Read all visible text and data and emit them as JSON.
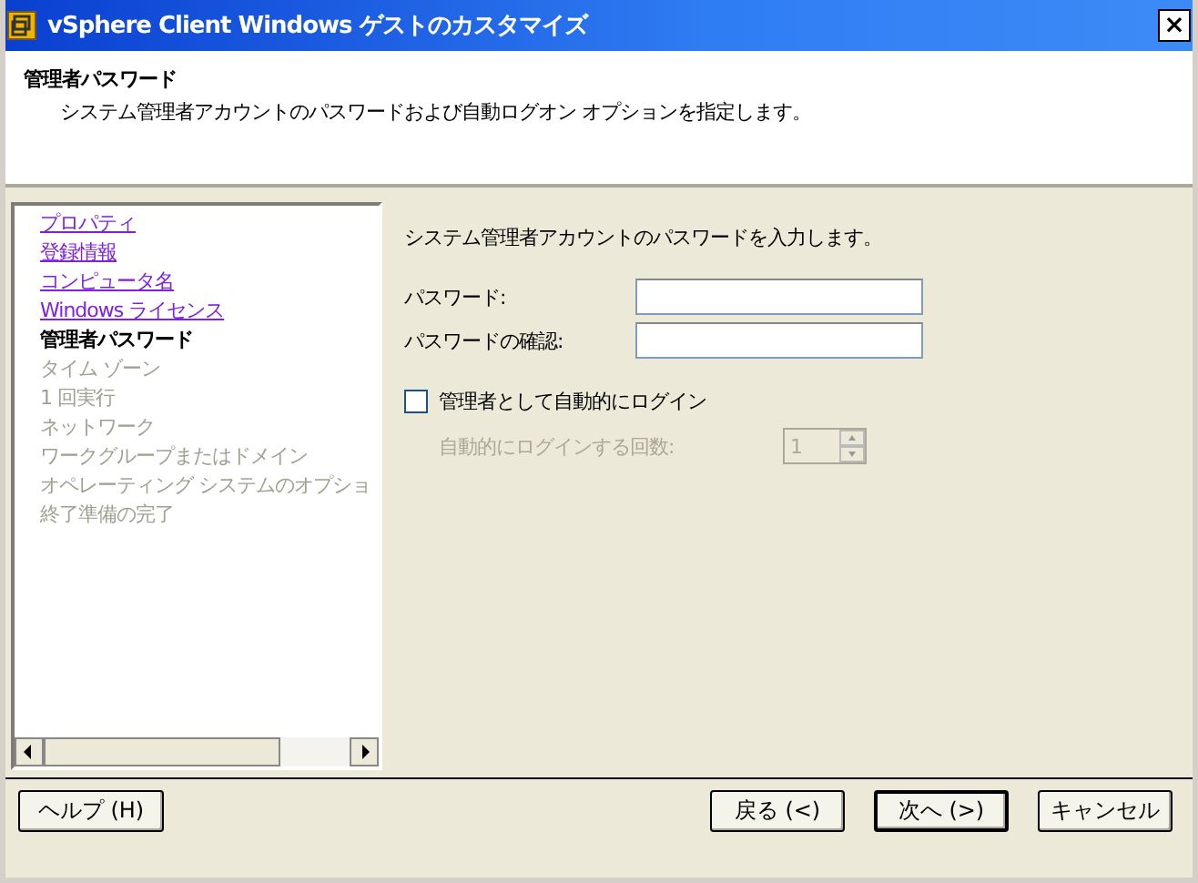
{
  "window": {
    "title": "vSphere Client Windows ゲストのカスタマイズ",
    "close": "×"
  },
  "header": {
    "title": "管理者パスワード",
    "description": "システム管理者アカウントのパスワードおよび自動ログオン オプションを指定します。"
  },
  "steps": [
    {
      "label": "プロパティ",
      "kind": "visited"
    },
    {
      "label": "登録情報",
      "kind": "visited"
    },
    {
      "label": "コンピュータ名",
      "kind": "visited"
    },
    {
      "label": "Windows ライセンス",
      "kind": "visited"
    },
    {
      "label": "管理者パスワード",
      "kind": "current"
    },
    {
      "label": "タイム ゾーン",
      "kind": "pending"
    },
    {
      "label": "1 回実行",
      "kind": "pending"
    },
    {
      "label": "ネットワーク",
      "kind": "pending"
    },
    {
      "label": "ワークグループまたはドメイン",
      "kind": "pending"
    },
    {
      "label": "オペレーティング システムのオプショ",
      "kind": "pending"
    },
    {
      "label": "終了準備の完了",
      "kind": "pending"
    }
  ],
  "form": {
    "intro": "システム管理者アカウントのパスワードを入力します。",
    "fields": [
      {
        "label": "パスワード:"
      },
      {
        "label": "パスワードの確認:"
      }
    ],
    "auto_login": {
      "label": "管理者として自動的にログイン",
      "checked": false
    },
    "login_count": {
      "label": "自動的にログインする回数:",
      "value": "1",
      "disabled": true
    }
  },
  "buttons": {
    "help": "ヘルプ (H)",
    "back": "戻る (<)",
    "next": "次へ (>)",
    "cancel": "キャンセル"
  }
}
